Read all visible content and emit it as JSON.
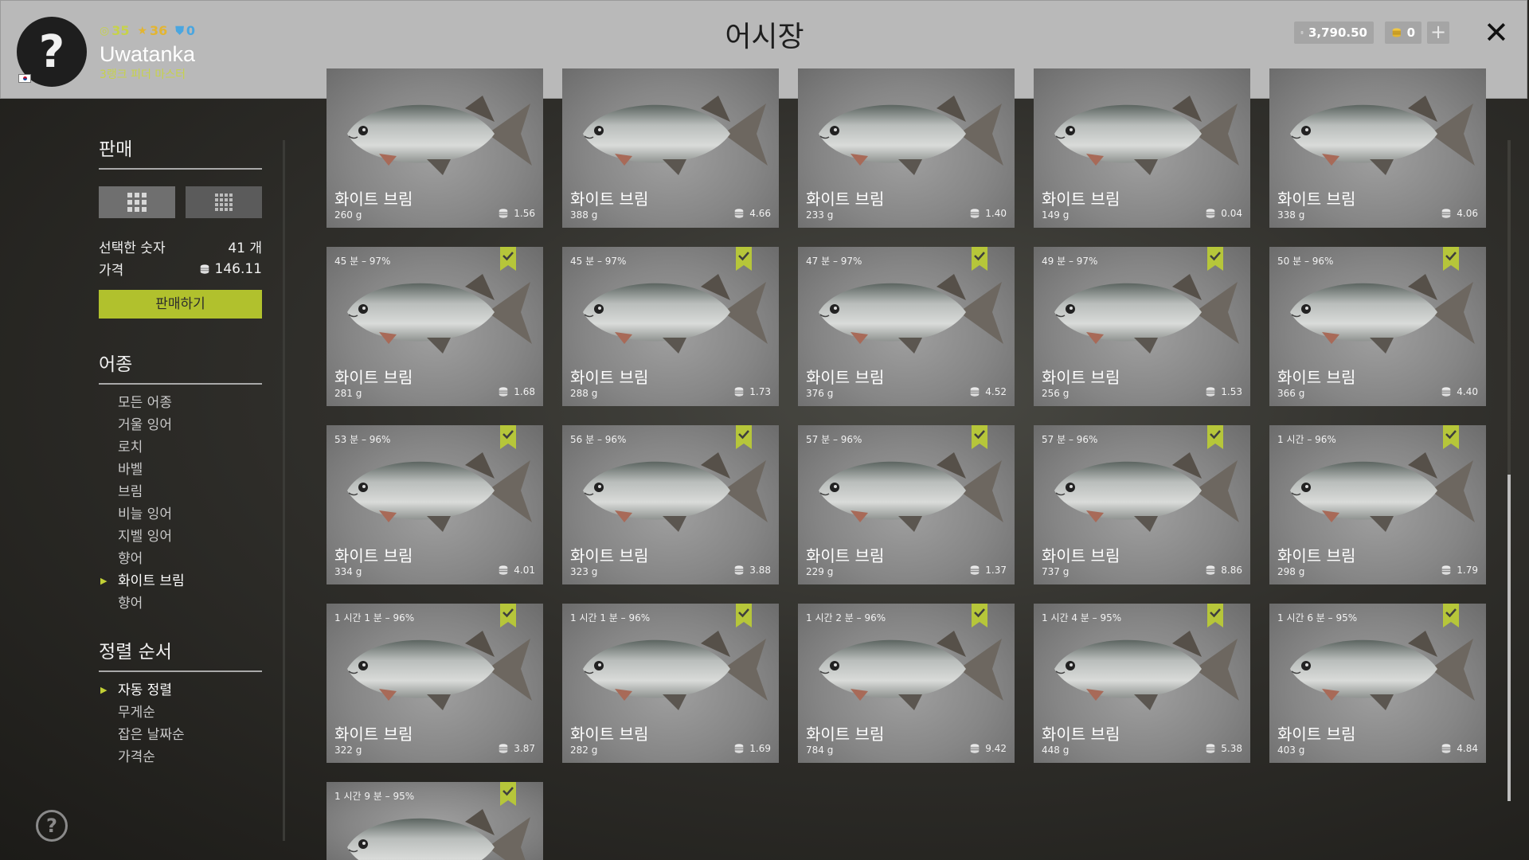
{
  "header": {
    "title": "어시장",
    "stats": {
      "level": "35",
      "stars": "36",
      "shield": "0"
    },
    "username": "Uwatanka",
    "rank": "3랭크 피더 마스터",
    "silver": "3,790.50",
    "gold": "0",
    "colors": {
      "level": "#c7d24a",
      "stars": "#e3b531",
      "shield": "#4aa6e0"
    }
  },
  "sidebar": {
    "sell_title": "판매",
    "selected_label": "선택한 숫자",
    "selected_value": "41 개",
    "price_label": "가격",
    "price_value": "146.11",
    "sell_button": "판매하기",
    "species_title": "어종",
    "species": [
      "모든 어종",
      "거울 잉어",
      "로치",
      "바벨",
      "브림",
      "비늘 잉어",
      "지벨 잉어",
      "향어",
      "화이트 브림",
      "향어"
    ],
    "species_selected_index": 8,
    "sort_title": "정렬 순서",
    "sort_options": [
      "자동 정렬",
      "무게순",
      "잡은 날짜순",
      "가격순"
    ],
    "sort_selected_index": 0
  },
  "cards": [
    {
      "time": "",
      "name": "화이트 브림",
      "weight": "260 g",
      "price": "1.56",
      "checked": false
    },
    {
      "time": "",
      "name": "화이트 브림",
      "weight": "388 g",
      "price": "4.66",
      "checked": false
    },
    {
      "time": "",
      "name": "화이트 브림",
      "weight": "233 g",
      "price": "1.40",
      "checked": false
    },
    {
      "time": "",
      "name": "화이트 브림",
      "weight": "149 g",
      "price": "0.04",
      "checked": false
    },
    {
      "time": "",
      "name": "화이트 브림",
      "weight": "338 g",
      "price": "4.06",
      "checked": false
    },
    {
      "time": "45 분 – 97%",
      "name": "화이트 브림",
      "weight": "281 g",
      "price": "1.68",
      "checked": true
    },
    {
      "time": "45 분 – 97%",
      "name": "화이트 브림",
      "weight": "288 g",
      "price": "1.73",
      "checked": true
    },
    {
      "time": "47 분 – 97%",
      "name": "화이트 브림",
      "weight": "376 g",
      "price": "4.52",
      "checked": true
    },
    {
      "time": "49 분 – 97%",
      "name": "화이트 브림",
      "weight": "256 g",
      "price": "1.53",
      "checked": true
    },
    {
      "time": "50 분 – 96%",
      "name": "화이트 브림",
      "weight": "366 g",
      "price": "4.40",
      "checked": true
    },
    {
      "time": "53 분 – 96%",
      "name": "화이트 브림",
      "weight": "334 g",
      "price": "4.01",
      "checked": true
    },
    {
      "time": "56 분 – 96%",
      "name": "화이트 브림",
      "weight": "323 g",
      "price": "3.88",
      "checked": true
    },
    {
      "time": "57 분 – 96%",
      "name": "화이트 브림",
      "weight": "229 g",
      "price": "1.37",
      "checked": true
    },
    {
      "time": "57 분 – 96%",
      "name": "화이트 브림",
      "weight": "737 g",
      "price": "8.86",
      "checked": true
    },
    {
      "time": "1 시간 – 96%",
      "name": "화이트 브림",
      "weight": "298 g",
      "price": "1.79",
      "checked": true
    },
    {
      "time": "1 시간 1 분 – 96%",
      "name": "화이트 브림",
      "weight": "322 g",
      "price": "3.87",
      "checked": true
    },
    {
      "time": "1 시간 1 분 – 96%",
      "name": "화이트 브림",
      "weight": "282 g",
      "price": "1.69",
      "checked": true
    },
    {
      "time": "1 시간 2 분 – 96%",
      "name": "화이트 브림",
      "weight": "784 g",
      "price": "9.42",
      "checked": true
    },
    {
      "time": "1 시간 4 분 – 95%",
      "name": "화이트 브림",
      "weight": "448 g",
      "price": "5.38",
      "checked": true
    },
    {
      "time": "1 시간 6 분 – 95%",
      "name": "화이트 브림",
      "weight": "403 g",
      "price": "4.84",
      "checked": true
    },
    {
      "time": "1 시간 9 분 – 95%",
      "name": "",
      "weight": "",
      "price": "",
      "checked": true
    }
  ],
  "icons": {
    "avatar": "question-mark-icon",
    "close": "close-icon",
    "add_currency": "plus-icon",
    "silver": "silver-coin-icon",
    "gold": "gold-coin-icon",
    "help": "help-icon",
    "check_badge": "check-badge-icon"
  },
  "colors": {
    "accent": "#b1c12d",
    "header_bg": "#b9b9b9",
    "card_bg": "#8a8a8a"
  }
}
